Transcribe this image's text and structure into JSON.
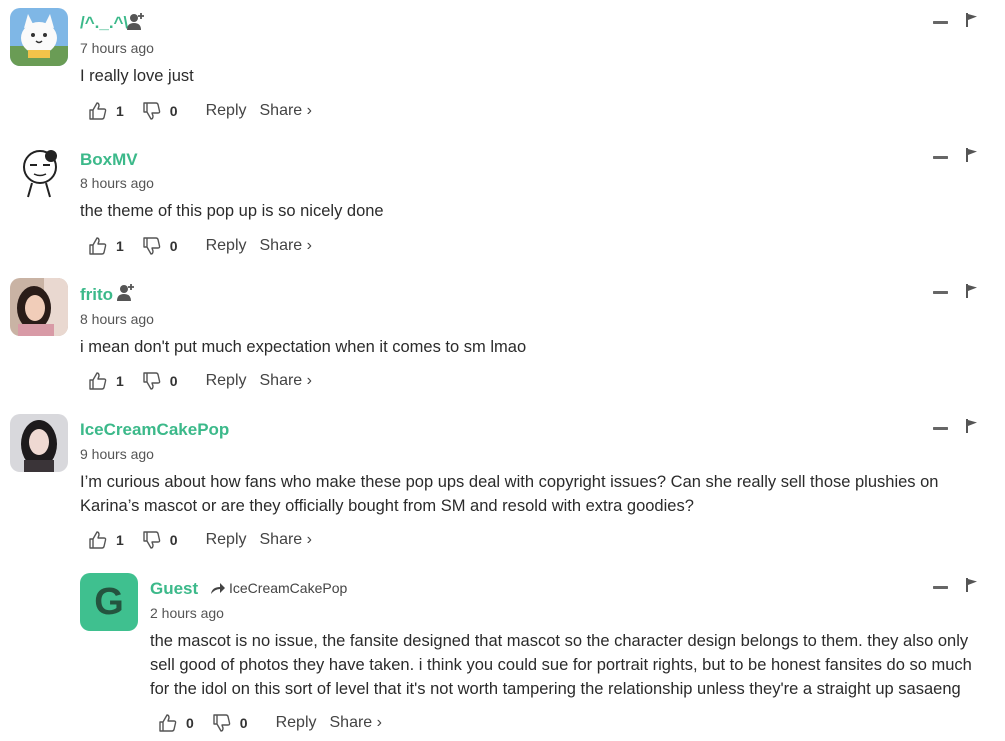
{
  "comments": [
    {
      "author": "/^._.^\\",
      "time": "7 hours ago",
      "text": "I really love just",
      "likes": "1",
      "dislikes": "0",
      "reply_label": "Reply",
      "share_label": "Share ›"
    },
    {
      "author": "BoxMV",
      "time": "8 hours ago",
      "text": "the theme of this pop up is so nicely done",
      "likes": "1",
      "dislikes": "0",
      "reply_label": "Reply",
      "share_label": "Share ›"
    },
    {
      "author": "frito",
      "time": "8 hours ago",
      "text": "i mean don't put much expectation when it comes to sm lmao",
      "likes": "1",
      "dislikes": "0",
      "reply_label": "Reply",
      "share_label": "Share ›"
    },
    {
      "author": "IceCreamCakePop",
      "time": "9 hours ago",
      "text_lines": [
        "I’m curious about how fans who make these pop ups deal with copyright issues? Can she really sell those plushies on",
        "Karina’s mascot or are they officially bought from SM and resold with extra goodies?"
      ],
      "likes": "1",
      "dislikes": "0",
      "reply_label": "Reply",
      "share_label": "Share ›"
    }
  ],
  "reply": {
    "avatar_letter": "G",
    "author": "Guest",
    "replying_to": "IceCreamCakePop",
    "time": "2 hours ago",
    "text_lines": [
      "the mascot is no issue, the fansite designed that mascot so the character design belongs to them. they also only",
      "sell good of photos they have taken. i think you could sue for portrait rights, but to be honest fansites do so much",
      "for the idol on this sort of level that it's not worth tampering the relationship unless they're a straight up sasaeng"
    ],
    "likes": "0",
    "dislikes": "0",
    "reply_label": "Reply",
    "share_label": "Share ›"
  },
  "icons": {
    "follow": "add-user-icon",
    "like": "thumbs-up-icon",
    "dislike": "thumbs-down-icon",
    "collapse": "minus-icon",
    "flag": "flag-icon",
    "reply_arrow": "reply-arrow-icon"
  },
  "colors": {
    "author": "#3cb98a",
    "guest_avatar": "#3fc08f",
    "text": "#2b2b2b"
  }
}
